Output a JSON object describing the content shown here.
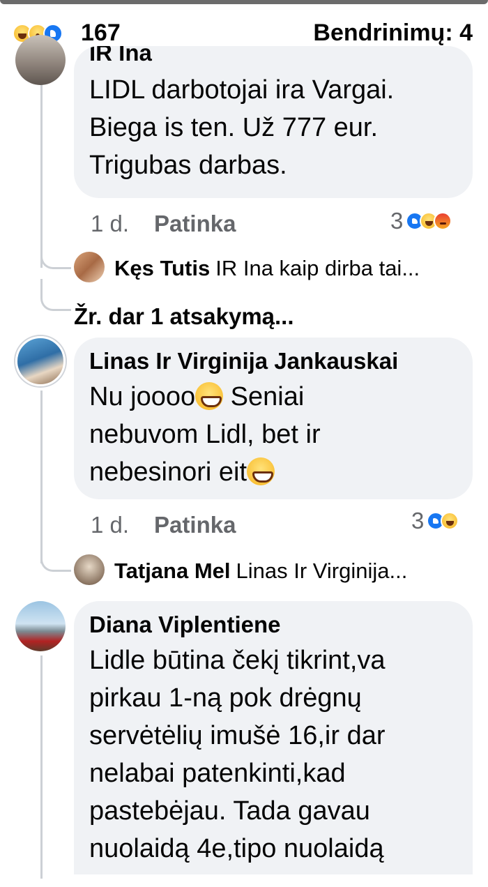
{
  "summary": {
    "reaction_icons": [
      "haha-icon",
      "wow-icon",
      "like-icon"
    ],
    "reaction_count": "167",
    "shares_label": "Bendrinimų: 4"
  },
  "comments": [
    {
      "author_cut": "IR Ina",
      "text": "LIDL darbotojai ira Vargai. Biega is ten. Už 777 eur. Trigubas darbas.",
      "time": "1 d.",
      "like_label": "Patinka",
      "reaction_count": "3",
      "reaction_icons": [
        "like-icon",
        "haha-icon",
        "angry-icon"
      ],
      "reply_preview": {
        "name": "Kęs Tutis",
        "text": "IR Ina  kaip dirba tai..."
      },
      "more_replies": "Žr. dar 1 atsakymą..."
    },
    {
      "author": "Linas Ir Virginija Jankauskai",
      "text_parts": [
        "Nu joooo",
        " Seniai nebuvom Lidl, bet ir nebesinori eit"
      ],
      "emoji": "grin-emoji",
      "time": "1 d.",
      "like_label": "Patinka",
      "reaction_count": "3",
      "reaction_icons": [
        "like-icon",
        "haha-icon"
      ],
      "reply_preview": {
        "name": "Tatjana Mel",
        "text": "Linas Ir Virginija..."
      }
    },
    {
      "author": "Diana Viplentiene",
      "text": "Lidle būtina čekį tikrint,va pirkau 1-ną pok drėgnų servėtėlių imušė 16,ir dar nelabai patenkinti,kad pastebėjau. Tada gavau nuolaidą 4e,tipo nuolaidą"
    }
  ]
}
